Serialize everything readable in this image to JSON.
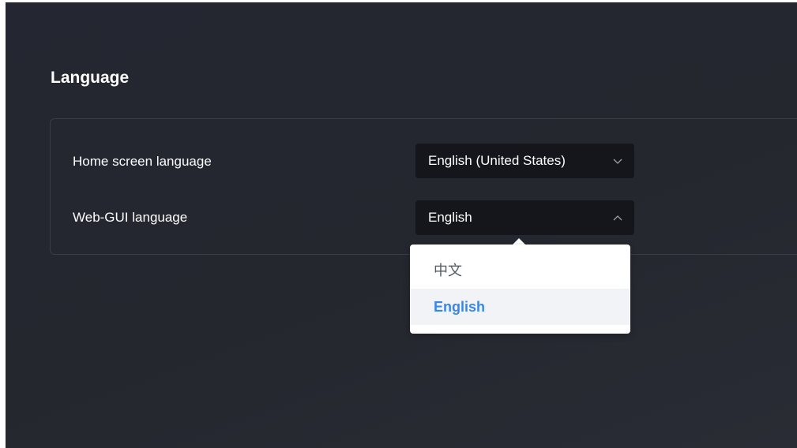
{
  "section": {
    "title": "Language"
  },
  "settings": [
    {
      "label": "Home screen language",
      "value": "English (United States)",
      "expanded": false
    },
    {
      "label": "Web-GUI language",
      "value": "English",
      "expanded": true
    }
  ],
  "dropdown": {
    "options": [
      {
        "label": "中文",
        "selected": false
      },
      {
        "label": "English",
        "selected": true
      }
    ]
  },
  "colors": {
    "background": "#25272f",
    "select_background": "#15161b",
    "selected_option": "#3a86e8"
  },
  "icons": {
    "collapsed": "chevron-down-icon",
    "expanded": "chevron-up-icon"
  }
}
